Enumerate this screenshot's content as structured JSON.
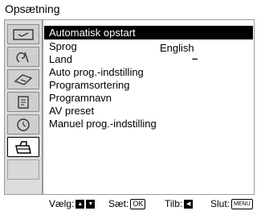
{
  "header": {
    "title": "Opsætning"
  },
  "sidebar": {
    "tabs": [
      {
        "icon": "picture-icon"
      },
      {
        "icon": "sound-icon"
      },
      {
        "icon": "screen-icon"
      },
      {
        "icon": "features-icon"
      },
      {
        "icon": "clock-icon"
      },
      {
        "icon": "toolbox-icon"
      },
      {
        "icon": ""
      }
    ]
  },
  "menu": {
    "items": [
      "Automatisk opstart",
      "Sprog",
      "Land",
      "Auto prog.-indstilling",
      "Programsortering",
      "Programnavn",
      "AV preset",
      "Manuel prog.-indstilling"
    ],
    "values": {
      "sprog": "English",
      "land": "–"
    }
  },
  "footer": {
    "select_label": "Vælg:",
    "set_label": "Sæt:",
    "set_key": "OK",
    "back_label": "Tilb:",
    "exit_label": "Slut:",
    "exit_key": "MENU"
  }
}
